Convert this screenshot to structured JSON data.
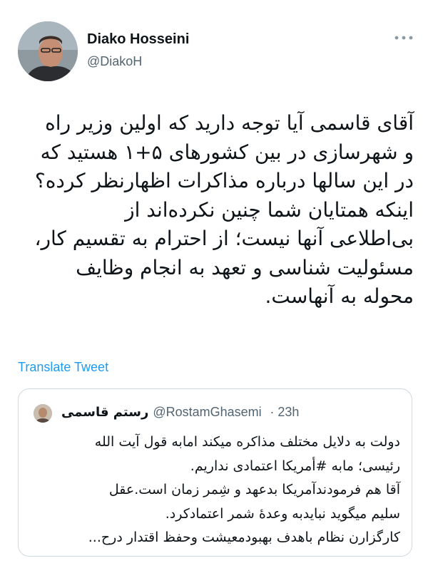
{
  "author": {
    "name": "Diako Hosseini",
    "handle": "@DiakoH",
    "avatar_icon": "profile-photo"
  },
  "more_icon": "ellipsis-icon",
  "tweet": {
    "text": "آقای قاسمی آیا توجه دارید که اولین وزیر راه\nو شهرسازی در بین کشورهای ۵+۱ هستید که\nدر این سالها درباره مذاکرات اظهارنظر کرده؟\nاینکه همتایان شما چنین نکرده‌اند از\nبی‌اطلاعی آنها نیست؛ از احترام به تقسیم کار،\nمسئولیت شناسی و تعهد به انجام وظایف\nمحوله به آنهاست."
  },
  "translate_label": "Translate Tweet",
  "quoted": {
    "name": "رستم قاسمی",
    "handle": "@RostamGhasemi",
    "time": "· 23h",
    "text": "دولت به دلایل مختلف مذاکره میکند امابه قول آیت الله\nرئیسی؛ مابه #أمریکا اعتمادی نداریم.\nآقا هم فرمودندآمریکا بدعهد و شِمر زمان است.عقل\nسلیم میگوید نبایدبه وعدهٔ شمر اعتمادکرد.\nکارگزارن نظام باهدف بهبودمعیشت وحفظ اقتدار درح..."
  },
  "colors": {
    "link": "#1d9bf0",
    "secondary_text": "#536471",
    "border": "#cfd9de"
  }
}
